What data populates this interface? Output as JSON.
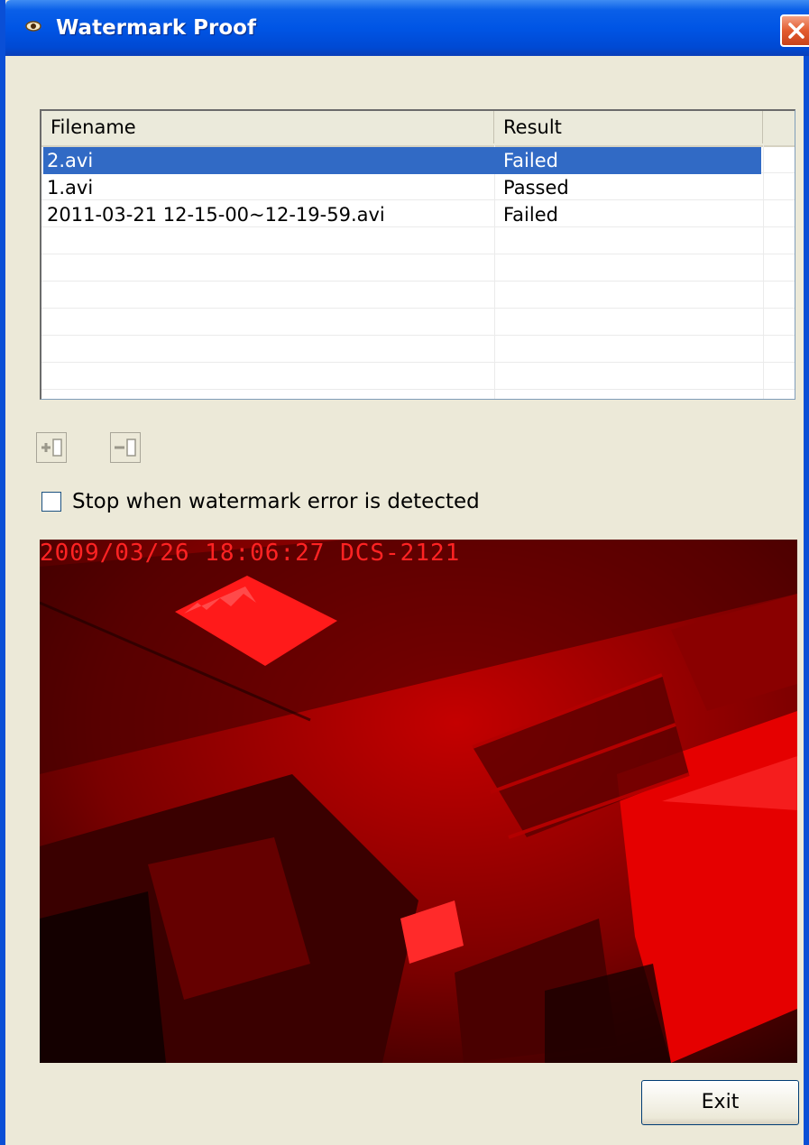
{
  "window": {
    "title": "Watermark Proof",
    "close_icon": "close-icon",
    "app_icon": "eye-icon"
  },
  "list": {
    "columns": [
      "Filename",
      "Result"
    ],
    "rows": [
      {
        "filename": "2.avi",
        "result": "Failed",
        "selected": true
      },
      {
        "filename": "1.avi",
        "result": "Passed",
        "selected": false
      },
      {
        "filename": "2011-03-21 12-15-00~12-19-59.avi",
        "result": "Failed",
        "selected": false
      }
    ]
  },
  "toolbar": {
    "add_icon": "add-file-icon",
    "remove_icon": "remove-file-icon"
  },
  "options": {
    "stop_label": "Stop when watermark error is detected",
    "stop_checked": false
  },
  "video": {
    "osd_text": "2009/03/26 18:06:27 DCS-2121"
  },
  "footer": {
    "exit_label": "Exit"
  },
  "colors": {
    "titlebar": "#0055e5",
    "selection": "#316ac5",
    "video_tint": "#ff0000"
  }
}
